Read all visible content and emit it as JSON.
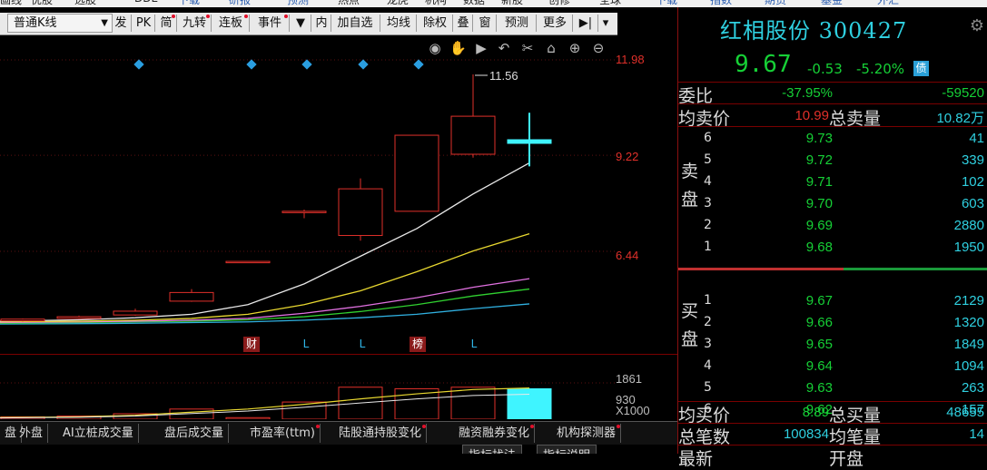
{
  "topbar": {
    "items": [
      "画线",
      "优股",
      "选股",
      "DDE",
      "下载",
      "研报",
      "预测",
      "热点",
      "龙虎",
      "机构",
      "数据",
      "新股",
      "创修",
      "全球",
      "下载",
      "指数",
      "期货",
      "基金",
      "外汇"
    ]
  },
  "toolbar": {
    "period": "普通K线",
    "buttons": [
      "发",
      "PK",
      "简",
      "九转",
      "连板",
      "事件",
      "内",
      "加自选",
      "均线",
      "除权",
      "叠",
      "窗",
      "预测",
      "更多"
    ]
  },
  "chart": {
    "high_label": "11.56",
    "axis_right": [
      "11.98",
      "9.22",
      "6.44"
    ],
    "vol_axis": [
      "1861",
      "930",
      "X1000"
    ],
    "markers": [
      "财",
      "L",
      "L",
      "榜",
      "L"
    ],
    "colors": {
      "up": "#e0302a",
      "axis": "#e0302a",
      "ma5": "#e8e8e8",
      "ma10": "#e8d830",
      "ma20": "#e070e0",
      "ma30": "#30d030",
      "ma60": "#30b0e0",
      "today_vol": "#3ff4ff"
    },
    "candles": [
      {
        "o": 4.43,
        "c": 4.48,
        "h": 4.5,
        "l": 4.41,
        "v": 60
      },
      {
        "o": 4.5,
        "c": 4.55,
        "h": 4.58,
        "l": 4.48,
        "v": 80
      },
      {
        "o": 4.6,
        "c": 4.71,
        "h": 4.78,
        "l": 4.58,
        "v": 140
      },
      {
        "o": 5.0,
        "c": 5.25,
        "h": 5.35,
        "l": 4.98,
        "v": 260
      },
      {
        "o": 6.15,
        "c": 6.15,
        "h": 6.15,
        "l": 6.15,
        "v": 40
      },
      {
        "o": 7.6,
        "c": 7.6,
        "h": 7.65,
        "l": 7.4,
        "v": 440
      },
      {
        "o": 6.9,
        "c": 8.25,
        "h": 8.55,
        "l": 6.75,
        "v": 820
      },
      {
        "o": 7.6,
        "c": 9.8,
        "h": 9.8,
        "l": 7.6,
        "v": 780
      },
      {
        "o": 9.25,
        "c": 10.35,
        "h": 11.56,
        "l": 9.15,
        "v": 820
      },
      {
        "o": 9.67,
        "c": 9.67,
        "h": 10.45,
        "l": 8.9,
        "v": 780
      }
    ],
    "ma": {
      "ma5": [
        4.42,
        4.46,
        4.52,
        4.62,
        4.9,
        5.5,
        6.3,
        7.1,
        8.1,
        9.0
      ],
      "ma10": [
        4.4,
        4.42,
        4.45,
        4.5,
        4.62,
        4.9,
        5.3,
        5.85,
        6.45,
        6.95
      ],
      "ma20": [
        4.38,
        4.4,
        4.42,
        4.45,
        4.5,
        4.65,
        4.85,
        5.1,
        5.4,
        5.65
      ],
      "ma30": [
        4.36,
        4.38,
        4.4,
        4.42,
        4.46,
        4.55,
        4.7,
        4.9,
        5.15,
        5.35
      ],
      "ma60": [
        4.34,
        4.35,
        4.36,
        4.38,
        4.4,
        4.45,
        4.52,
        4.62,
        4.78,
        4.92
      ]
    },
    "vol_ma": [
      40,
      60,
      100,
      180,
      260,
      380,
      520,
      650,
      760,
      800
    ]
  },
  "bottom_tabs": [
    "盘",
    "外盘",
    "AI立桩成交量",
    "盘后成交量",
    "市盈率(ttm)",
    "陆股通持股变化",
    "融资融券变化",
    "机构探测器"
  ],
  "bottom_tabs2": [
    "指标找法",
    "指标说明"
  ],
  "quote": {
    "name": "红相股份 300427",
    "price": "9.67",
    "change": "-0.53",
    "change_pct": "-5.20%",
    "bond_badge": "债",
    "weibi_label": "委比",
    "weibi_pct": "-37.95%",
    "weibi_val": "-59520",
    "avg_ask_label": "均卖价",
    "avg_ask": "10.99",
    "total_ask_label": "总卖量",
    "total_ask": "10.82万",
    "sell_label": "卖盘",
    "buy_label": "买盘",
    "sell": [
      {
        "lvl": "6",
        "price": "9.73",
        "vol": "41"
      },
      {
        "lvl": "5",
        "price": "9.72",
        "vol": "339"
      },
      {
        "lvl": "4",
        "price": "9.71",
        "vol": "102"
      },
      {
        "lvl": "3",
        "price": "9.70",
        "vol": "603"
      },
      {
        "lvl": "2",
        "price": "9.69",
        "vol": "2880"
      },
      {
        "lvl": "1",
        "price": "9.68",
        "vol": "1950"
      }
    ],
    "buy": [
      {
        "lvl": "1",
        "price": "9.67",
        "vol": "2129"
      },
      {
        "lvl": "2",
        "price": "9.66",
        "vol": "1320"
      },
      {
        "lvl": "3",
        "price": "9.65",
        "vol": "1849"
      },
      {
        "lvl": "4",
        "price": "9.64",
        "vol": "1094"
      },
      {
        "lvl": "5",
        "price": "9.63",
        "vol": "263"
      },
      {
        "lvl": "6",
        "price": "9.62",
        "vol": "157"
      }
    ],
    "avg_bid_label": "均买价",
    "avg_bid": "8.89",
    "total_bid_label": "总买量",
    "total_bid": "48655",
    "trades_label": "总笔数",
    "trades": "100834",
    "avg_trade_label": "均笔量",
    "avg_trade": "14",
    "latest_label": "最新",
    "open_label": "开盘"
  }
}
